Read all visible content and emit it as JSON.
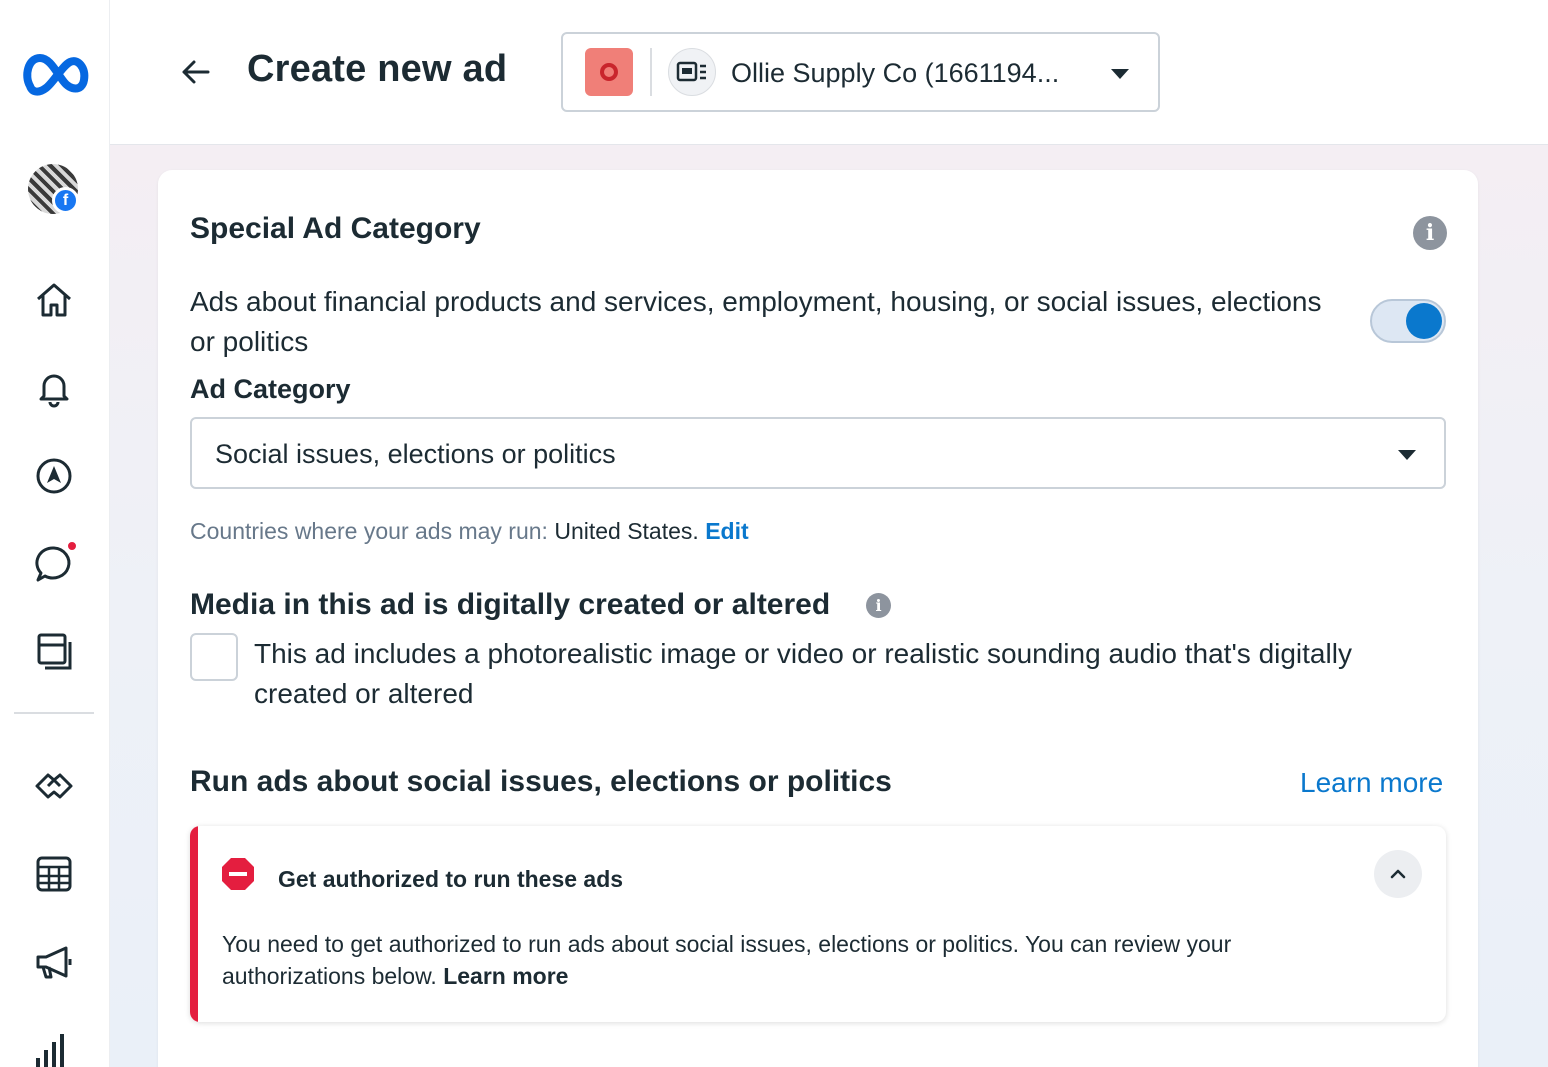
{
  "topbar": {
    "title": "Create new ad",
    "account_name": "Ollie Supply Co (1661194..."
  },
  "sidebar": {
    "items": [
      {
        "icon": "home-icon"
      },
      {
        "icon": "bell-icon"
      },
      {
        "icon": "navigation-icon"
      },
      {
        "icon": "chat-icon"
      },
      {
        "icon": "pages-icon"
      },
      {
        "icon": "handshake-icon"
      },
      {
        "icon": "calendar-table-icon"
      },
      {
        "icon": "megaphone-icon"
      },
      {
        "icon": "bar-chart-icon"
      }
    ],
    "avatar_badge": "f"
  },
  "special_ad": {
    "title": "Special Ad Category",
    "description": "Ads about financial products and services, employment, housing, or social issues, elections or politics",
    "toggle_on": true,
    "ad_category_label": "Ad Category",
    "ad_category_value": "Social issues, elections or politics",
    "countries_prefix": "Countries where your ads may run:",
    "countries_value": "United States.",
    "countries_edit": "Edit"
  },
  "media": {
    "title": "Media in this ad is digitally created or altered",
    "checkbox_label": "This ad includes a photorealistic image or video or realistic sounding audio that's digitally created or altered",
    "checked": false
  },
  "run_ads": {
    "title": "Run ads about social issues, elections or politics",
    "learn_more": "Learn more"
  },
  "alert": {
    "title": "Get authorized to run these ads",
    "body": "You need to get authorized to run ads about social issues, elections or politics. You can review your authorizations below.",
    "learn_more": "Learn more"
  },
  "colors": {
    "accent": "#0a78cd",
    "error": "#e41e3f",
    "meta_blue": "#0668e1"
  }
}
